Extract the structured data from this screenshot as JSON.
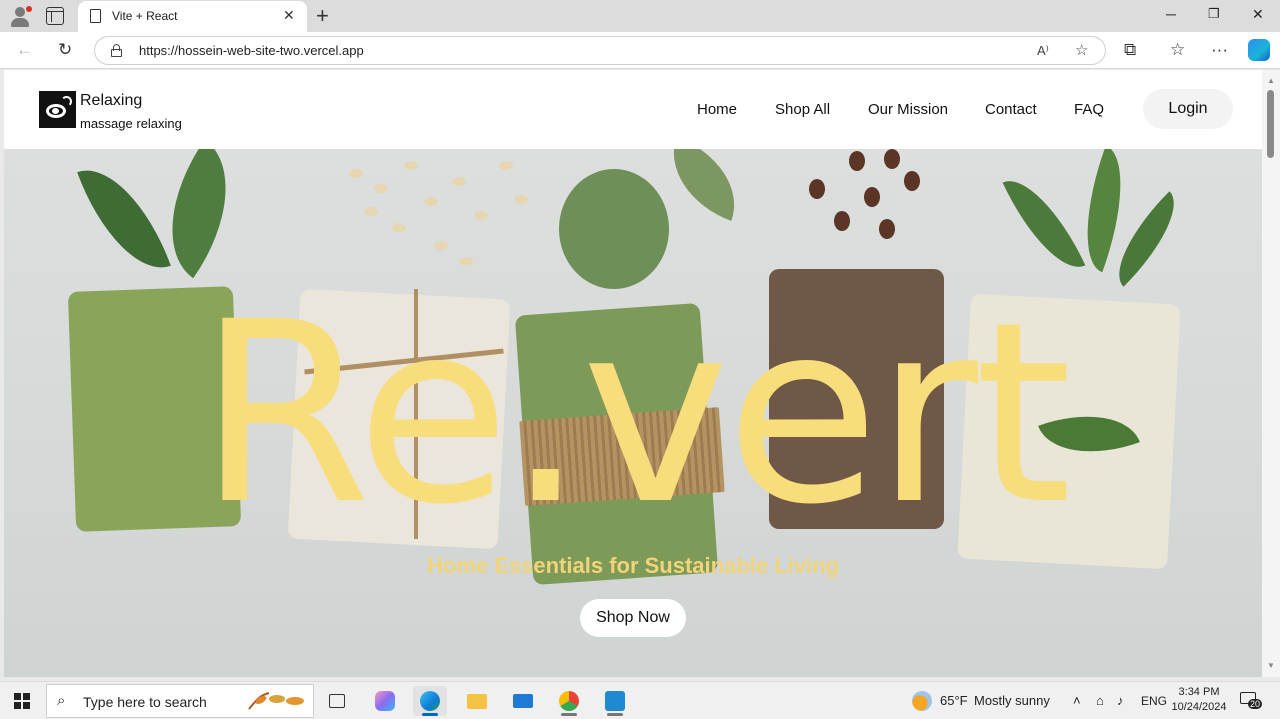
{
  "browser": {
    "tab_title": "Vite + React",
    "url": "https://hossein-web-site-two.vercel.app"
  },
  "site": {
    "brand_name": "Relaxing",
    "brand_tagline": "massage relaxing",
    "nav": [
      {
        "label": "Home"
      },
      {
        "label": "Shop All"
      },
      {
        "label": "Our Mission"
      },
      {
        "label": "Contact"
      },
      {
        "label": "FAQ"
      }
    ],
    "login_label": "Login",
    "hero": {
      "title": "Re.vert",
      "subtitle": "Home Essentials for Sustainable Living",
      "cta_label": "Shop Now",
      "title_color": "#f8dd7d"
    }
  },
  "taskbar": {
    "search_placeholder": "Type here to search",
    "weather_temp": "65°F",
    "weather_desc": "Mostly sunny",
    "language": "ENG",
    "time": "3:34 PM",
    "date": "10/24/2024",
    "notification_count": "20"
  }
}
